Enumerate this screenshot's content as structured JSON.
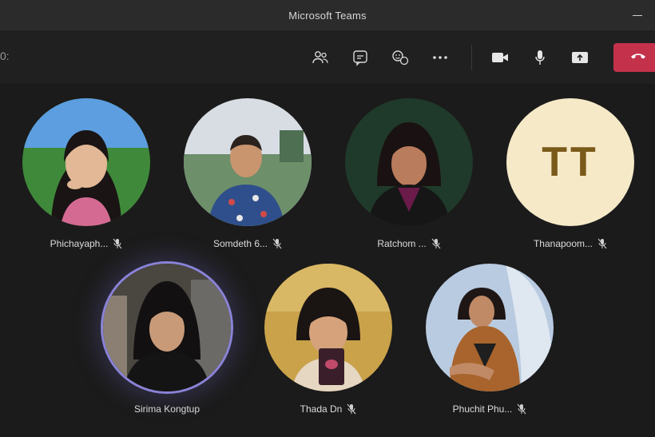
{
  "window": {
    "title": "Microsoft Teams"
  },
  "toolbar": {
    "elapsed": "0:",
    "buttons": [
      {
        "name": "people",
        "icon": "people-icon"
      },
      {
        "name": "chat",
        "icon": "chat-icon"
      },
      {
        "name": "react",
        "icon": "react-icon"
      },
      {
        "name": "more",
        "icon": "more-icon"
      },
      {
        "name": "camera",
        "icon": "camera-icon"
      },
      {
        "name": "mic",
        "icon": "mic-icon"
      },
      {
        "name": "share",
        "icon": "share-icon"
      }
    ],
    "leave": {
      "icon": "hangup-icon",
      "color": "#c4314b"
    }
  },
  "participants": [
    {
      "name": "Phichayaph...",
      "muted": true
    },
    {
      "name": "Somdeth 6...",
      "muted": true
    },
    {
      "name": "Ratchom ...",
      "muted": true
    },
    {
      "name": "Thanapoom...",
      "initials": "TT",
      "muted": true
    },
    {
      "name": "Sirima Kongtup",
      "muted": false,
      "speaking": true
    },
    {
      "name": "Thada Dn",
      "muted": true
    },
    {
      "name": "Phuchit Phu...",
      "muted": true
    }
  ],
  "colors": {
    "speaking_ring": "#8a83d8",
    "initials_bg": "#f6e9c8",
    "initials_fg": "#7a5a1a"
  }
}
